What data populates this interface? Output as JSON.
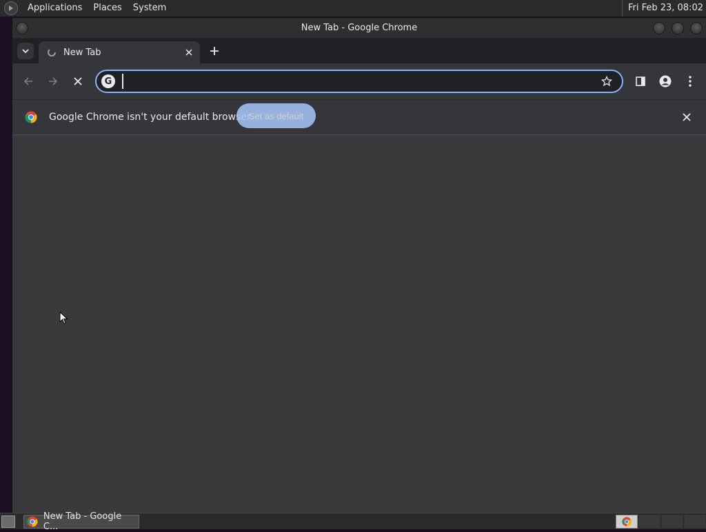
{
  "top_panel": {
    "menus": [
      "Applications",
      "Places",
      "System"
    ],
    "clock": "Fri Feb 23, 08:02"
  },
  "window": {
    "title": "New Tab - Google Chrome"
  },
  "tabs": [
    {
      "title": "New Tab",
      "icon": "loading-spinner-icon"
    }
  ],
  "toolbar": {
    "omnibox_value": "",
    "omnibox_icon": "google-g-icon"
  },
  "infobar": {
    "message": "Google Chrome isn't your default browser",
    "button": "Set as default"
  },
  "taskbar": {
    "items": [
      {
        "label": "New Tab - Google C..."
      }
    ]
  },
  "colors": {
    "accent": "#8ab4f8",
    "button_bg": "#a8c7fa",
    "content_bg": "#3a3a3d",
    "toolbar_bg": "#35363a",
    "tabstrip_bg": "#202124"
  }
}
